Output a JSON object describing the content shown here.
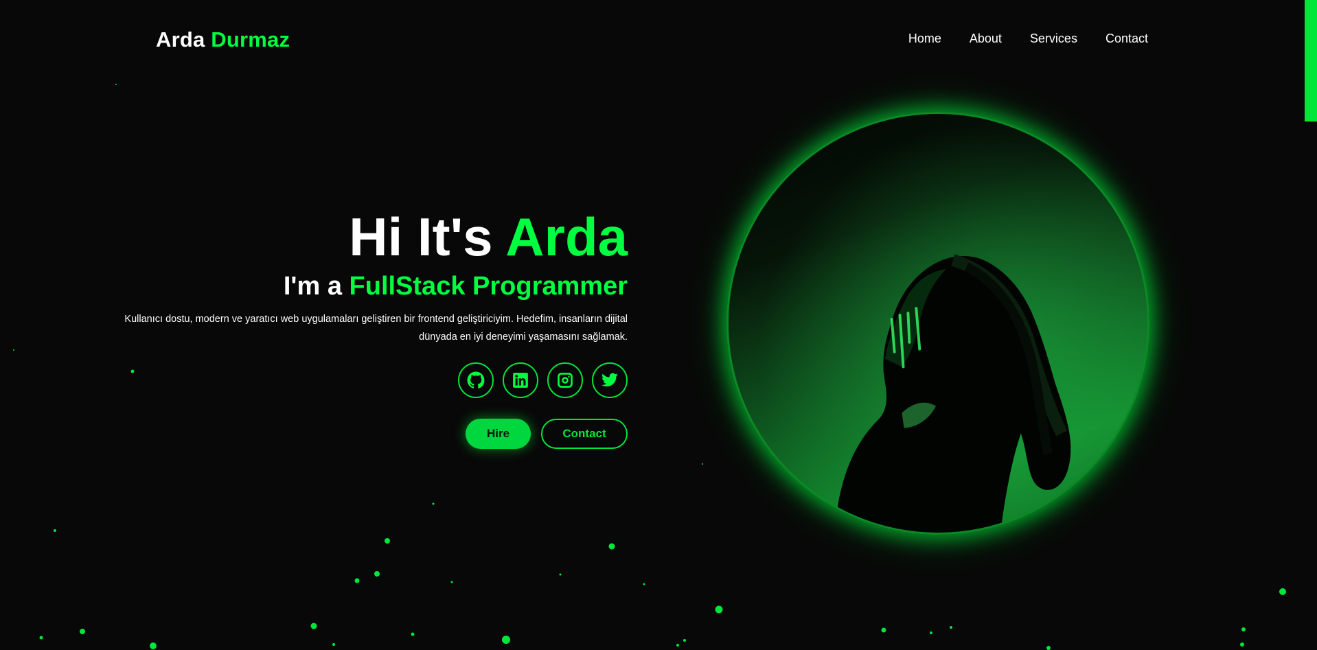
{
  "header": {
    "logo_first": "Arda",
    "logo_last": "Durmaz",
    "nav": [
      {
        "label": "Home"
      },
      {
        "label": "About"
      },
      {
        "label": "Services"
      },
      {
        "label": "Contact"
      }
    ]
  },
  "hero": {
    "greeting": "Hi It's",
    "name": "Arda",
    "role_prefix": "I'm a",
    "role": "FullStack Programmer",
    "description": "Kullanıcı dostu, modern ve yaratıcı web uygulamaları geliştiren bir frontend geliştiriciyim. Hedefim, insanların dijital dünyada en iyi deneyimi yaşamasını sağlamak.",
    "socials": [
      {
        "icon": "github-icon"
      },
      {
        "icon": "linkedin-icon"
      },
      {
        "icon": "instagram-icon"
      },
      {
        "icon": "twitter-icon"
      }
    ],
    "buttons": {
      "hire": "Hire",
      "contact": "Contact"
    }
  },
  "colors": {
    "accent": "#00ff41",
    "background": "#080808",
    "text": "#ffffff"
  }
}
